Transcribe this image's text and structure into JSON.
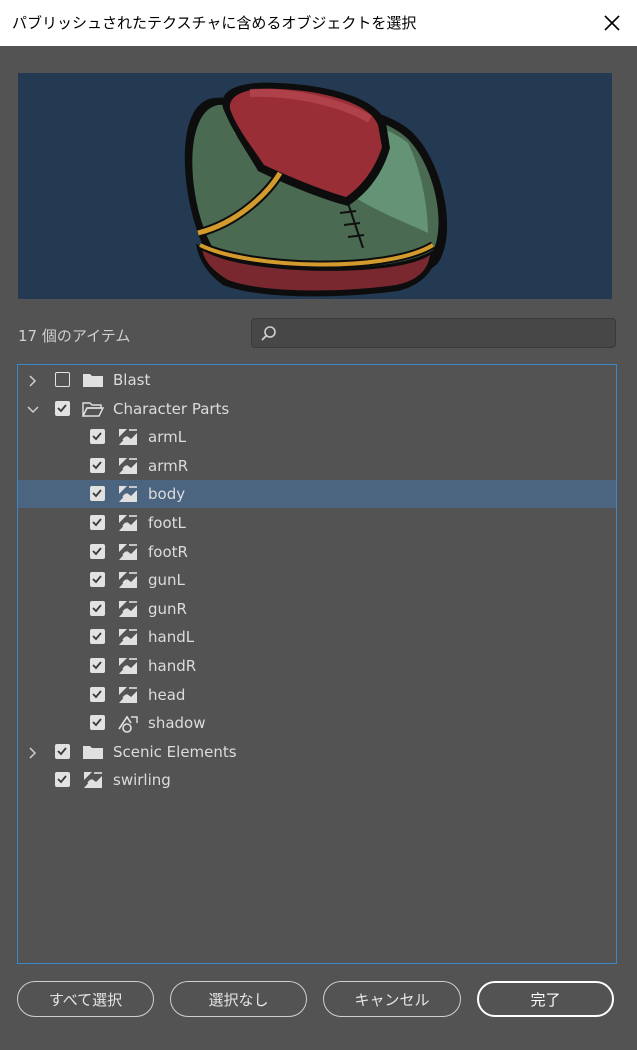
{
  "dialog": {
    "title": "パブリッシュされたテクスチャに含めるオブジェクトを選択"
  },
  "list": {
    "item_count": "17 個のアイテム",
    "search_placeholder": "",
    "items": [
      {
        "label": "Blast",
        "type": "folder",
        "checked": false,
        "expanded": false,
        "indent": 0
      },
      {
        "label": "Character Parts",
        "type": "folder-open",
        "checked": true,
        "expanded": true,
        "indent": 0
      },
      {
        "label": "armL",
        "type": "texture",
        "checked": true,
        "indent": 1
      },
      {
        "label": "armR",
        "type": "texture",
        "checked": true,
        "indent": 1
      },
      {
        "label": "body",
        "type": "texture",
        "checked": true,
        "indent": 1,
        "selected": true
      },
      {
        "label": "footL",
        "type": "texture",
        "checked": true,
        "indent": 1
      },
      {
        "label": "footR",
        "type": "texture",
        "checked": true,
        "indent": 1
      },
      {
        "label": "gunL",
        "type": "texture",
        "checked": true,
        "indent": 1
      },
      {
        "label": "gunR",
        "type": "texture",
        "checked": true,
        "indent": 1
      },
      {
        "label": "handL",
        "type": "texture",
        "checked": true,
        "indent": 1
      },
      {
        "label": "handR",
        "type": "texture",
        "checked": true,
        "indent": 1
      },
      {
        "label": "head",
        "type": "texture",
        "checked": true,
        "indent": 1
      },
      {
        "label": "shadow",
        "type": "shadow",
        "checked": true,
        "indent": 1
      },
      {
        "label": "Scenic Elements",
        "type": "folder",
        "checked": true,
        "expanded": false,
        "indent": 0
      },
      {
        "label": "swirling",
        "type": "texture",
        "checked": true,
        "indent": 0,
        "no_chevron": true
      }
    ]
  },
  "buttons": {
    "select_all": "すべて選択",
    "select_none": "選択なし",
    "cancel": "キャンセル",
    "done": "完了"
  },
  "colors": {
    "panel_bg": "#535353",
    "preview_bg": "#243a52",
    "selection": "#4b6480",
    "focus_border": "#3c87c9"
  }
}
